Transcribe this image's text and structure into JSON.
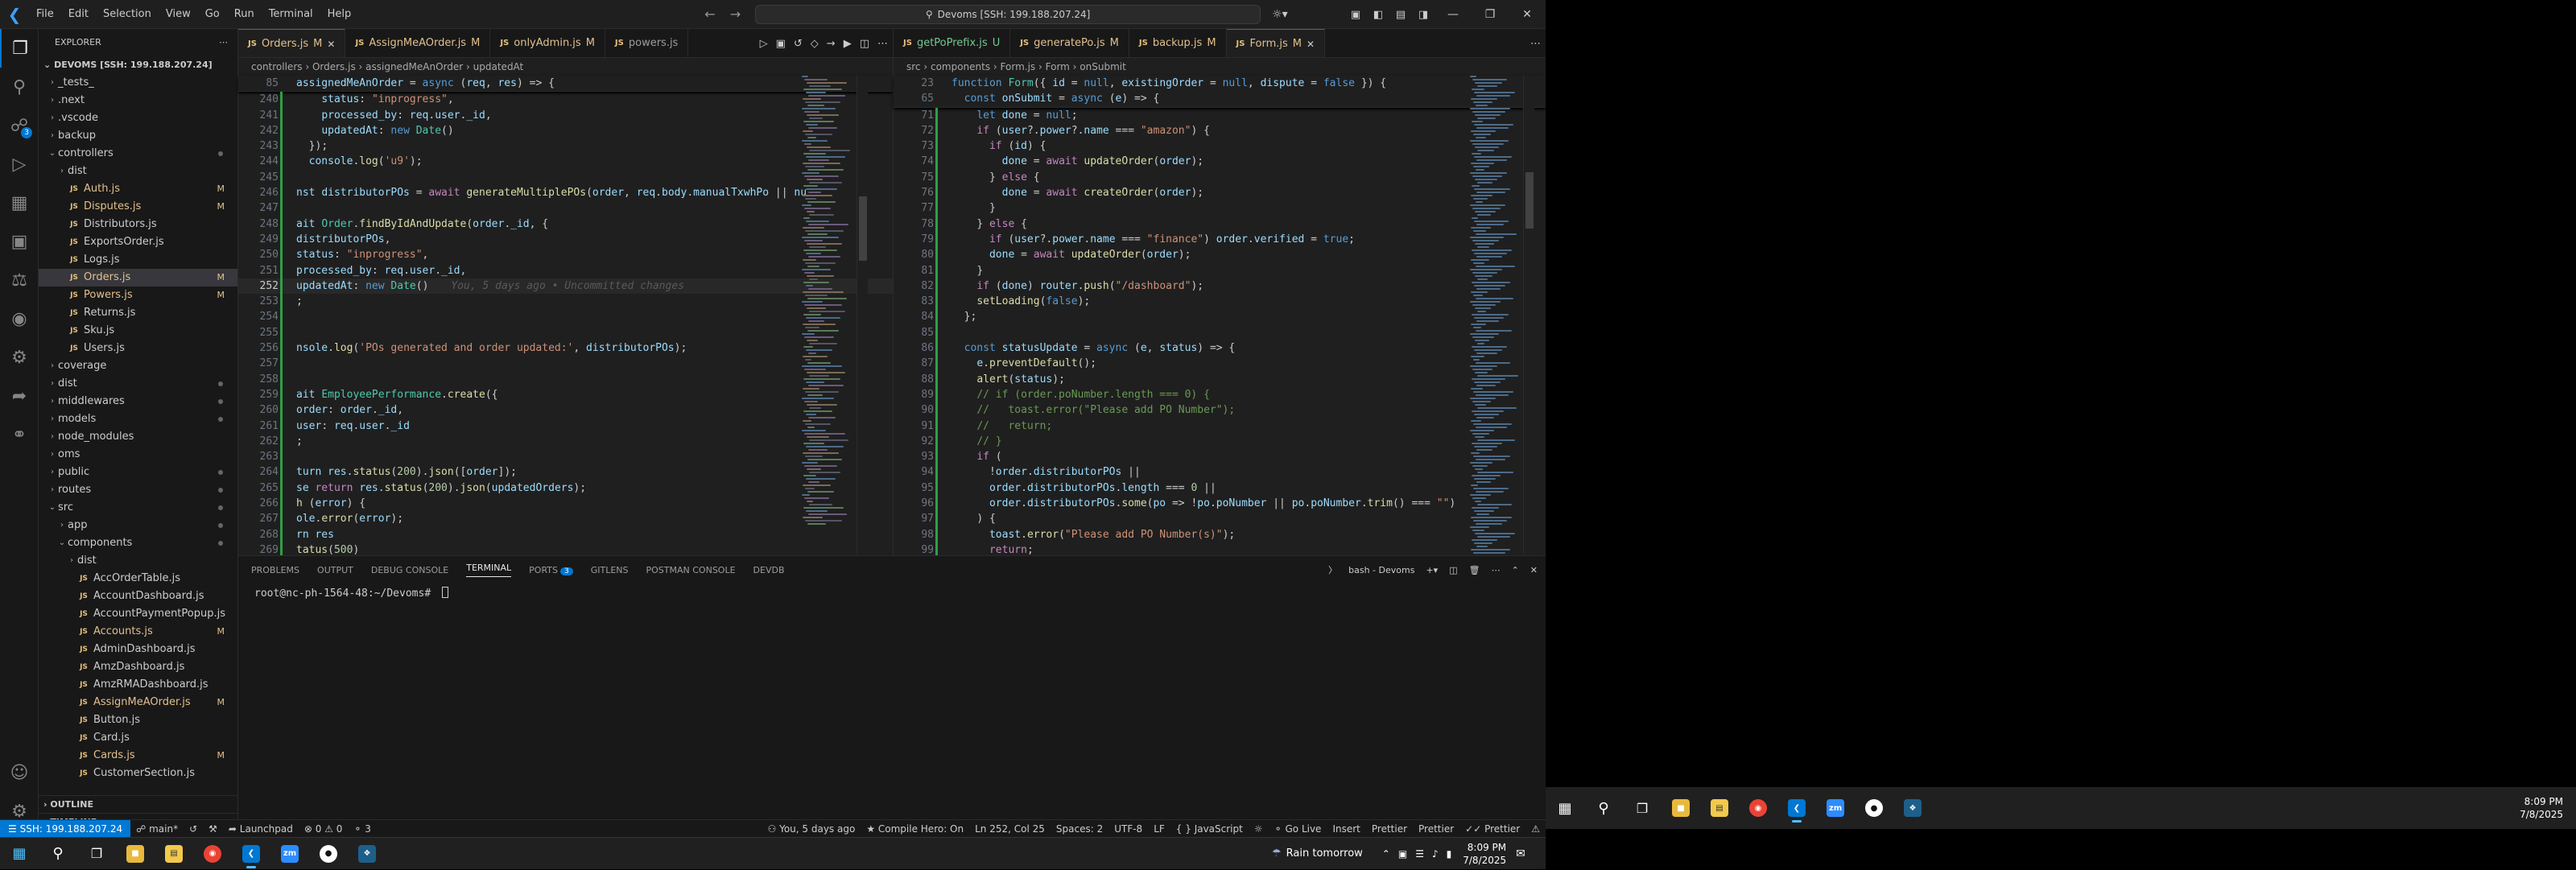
{
  "window": {
    "menus": [
      "File",
      "Edit",
      "Selection",
      "View",
      "Go",
      "Run",
      "Terminal",
      "Help"
    ],
    "command_center": "Devoms [SSH: 199.188.207.24]"
  },
  "explorer": {
    "title": "EXPLORER",
    "root": "DEVOMS [SSH: 199.188.207.24]",
    "items": [
      {
        "label": "_tests_",
        "type": "folder",
        "depth": 0,
        "open": false
      },
      {
        "label": ".next",
        "type": "folder",
        "depth": 0,
        "open": false
      },
      {
        "label": ".vscode",
        "type": "folder",
        "depth": 0,
        "open": false
      },
      {
        "label": "backup",
        "type": "folder",
        "depth": 0,
        "open": false
      },
      {
        "label": "controllers",
        "type": "folder",
        "depth": 0,
        "open": true,
        "dot": true
      },
      {
        "label": "dist",
        "type": "folder",
        "depth": 1,
        "open": false
      },
      {
        "label": "Auth.js",
        "type": "js",
        "depth": 1,
        "status": "M"
      },
      {
        "label": "Disputes.js",
        "type": "js",
        "depth": 1,
        "status": "M"
      },
      {
        "label": "Distributors.js",
        "type": "js",
        "depth": 1
      },
      {
        "label": "ExportsOrder.js",
        "type": "js",
        "depth": 1
      },
      {
        "label": "Logs.js",
        "type": "js",
        "depth": 1
      },
      {
        "label": "Orders.js",
        "type": "js",
        "depth": 1,
        "status": "M",
        "selected": true
      },
      {
        "label": "Powers.js",
        "type": "js",
        "depth": 1,
        "status": "M"
      },
      {
        "label": "Returns.js",
        "type": "js",
        "depth": 1
      },
      {
        "label": "Sku.js",
        "type": "js",
        "depth": 1
      },
      {
        "label": "Users.js",
        "type": "js",
        "depth": 1
      },
      {
        "label": "coverage",
        "type": "folder",
        "depth": 0,
        "open": false
      },
      {
        "label": "dist",
        "type": "folder",
        "depth": 0,
        "open": false,
        "dot": true
      },
      {
        "label": "middlewares",
        "type": "folder",
        "depth": 0,
        "open": false,
        "dot": true
      },
      {
        "label": "models",
        "type": "folder",
        "depth": 0,
        "open": false,
        "dot": true
      },
      {
        "label": "node_modules",
        "type": "folder",
        "depth": 0,
        "open": false
      },
      {
        "label": "oms",
        "type": "folder",
        "depth": 0,
        "open": false
      },
      {
        "label": "public",
        "type": "folder",
        "depth": 0,
        "open": false,
        "dot": true
      },
      {
        "label": "routes",
        "type": "folder",
        "depth": 0,
        "open": false,
        "dot": true
      },
      {
        "label": "src",
        "type": "folder",
        "depth": 0,
        "open": true,
        "dot": true
      },
      {
        "label": "app",
        "type": "folder",
        "depth": 1,
        "open": false,
        "dot": true
      },
      {
        "label": "components",
        "type": "folder",
        "depth": 1,
        "open": true,
        "dot": true
      },
      {
        "label": "dist",
        "type": "folder",
        "depth": 2,
        "open": false
      },
      {
        "label": "AccOrderTable.js",
        "type": "js",
        "depth": 2
      },
      {
        "label": "AccountDashboard.js",
        "type": "js",
        "depth": 2
      },
      {
        "label": "AccountPaymentPopup.js",
        "type": "js",
        "depth": 2
      },
      {
        "label": "Accounts.js",
        "type": "js",
        "depth": 2,
        "status": "M"
      },
      {
        "label": "AdminDashboard.js",
        "type": "js",
        "depth": 2
      },
      {
        "label": "AmzDashboard.js",
        "type": "js",
        "depth": 2
      },
      {
        "label": "AmzRMADashboard.js",
        "type": "js",
        "depth": 2
      },
      {
        "label": "AssignMeAOrder.js",
        "type": "js",
        "depth": 2,
        "status": "M"
      },
      {
        "label": "Button.js",
        "type": "js",
        "depth": 2
      },
      {
        "label": "Card.js",
        "type": "js",
        "depth": 2
      },
      {
        "label": "Cards.js",
        "type": "js",
        "depth": 2,
        "status": "M"
      },
      {
        "label": "CustomerSection.js",
        "type": "js",
        "depth": 2
      }
    ],
    "outline": "OUTLINE",
    "timeline": "TIMELINE"
  },
  "editor_left": {
    "tabs": [
      {
        "label": "Orders.js",
        "status": "M",
        "active": true
      },
      {
        "label": "AssignMeAOrder.js",
        "status": "M"
      },
      {
        "label": "onlyAdmin.js",
        "status": "M"
      },
      {
        "label": "powers.js",
        "status": ""
      }
    ],
    "breadcrumb": [
      "controllers",
      "Orders.js",
      "assignedMeAnOrder",
      "updatedAt"
    ],
    "sticky": {
      "ln": "85",
      "text": "assignedMeAnOrder = async (req, res) => {"
    },
    "lines": [
      {
        "ln": "240",
        "t": "    status: \"inprogress\","
      },
      {
        "ln": "241",
        "t": "    processed_by: req.user._id,"
      },
      {
        "ln": "242",
        "t": "    updatedAt: new Date()"
      },
      {
        "ln": "243",
        "t": "  });"
      },
      {
        "ln": "244",
        "t": "  console.log('u9');"
      },
      {
        "ln": "245",
        "t": ""
      },
      {
        "ln": "246",
        "t": "nst distributorPOs = await generateMultiplePOs(order, req.body.manualTxwhPo || nu"
      },
      {
        "ln": "247",
        "t": ""
      },
      {
        "ln": "248",
        "t": "ait Order.findByIdAndUpdate(order._id, {"
      },
      {
        "ln": "249",
        "t": "distributorPOs,"
      },
      {
        "ln": "250",
        "t": "status: \"inprogress\","
      },
      {
        "ln": "251",
        "t": "processed_by: req.user._id,"
      },
      {
        "ln": "252",
        "t": "updatedAt: new Date()"
      },
      {
        "ln": "253",
        "t": ";"
      },
      {
        "ln": "254",
        "t": ""
      },
      {
        "ln": "255",
        "t": ""
      },
      {
        "ln": "256",
        "t": "nsole.log('POs generated and order updated:', distributorPOs);"
      },
      {
        "ln": "257",
        "t": ""
      },
      {
        "ln": "258",
        "t": ""
      },
      {
        "ln": "259",
        "t": "ait EmployeePerformance.create({"
      },
      {
        "ln": "260",
        "t": "order: order._id,"
      },
      {
        "ln": "261",
        "t": "user: req.user._id"
      },
      {
        "ln": "262",
        "t": ";"
      },
      {
        "ln": "263",
        "t": ""
      },
      {
        "ln": "264",
        "t": "turn res.status(200).json([order]);"
      },
      {
        "ln": "265",
        "t": "se return res.status(200).json(updatedOrders);"
      },
      {
        "ln": "266",
        "t": "h (error) {"
      },
      {
        "ln": "267",
        "t": "ole.error(error);"
      },
      {
        "ln": "268",
        "t": "rn res"
      },
      {
        "ln": "269",
        "t": "tatus(500)"
      }
    ],
    "current_line": "252",
    "blame": "You, 5 days ago • Uncommitted changes"
  },
  "editor_right": {
    "tabs": [
      {
        "label": "getPoPrefix.js",
        "status": "U"
      },
      {
        "label": "generatePo.js",
        "status": "M"
      },
      {
        "label": "backup.js",
        "status": "M"
      },
      {
        "label": "Form.js",
        "status": "M",
        "active": true
      }
    ],
    "breadcrumb": [
      "src",
      "components",
      "Form.js",
      "Form",
      "onSubmit"
    ],
    "sticky": [
      {
        "ln": "23",
        "text": "function Form({ id = null, existingOrder = null, dispute = false }) {"
      },
      {
        "ln": "65",
        "text": "  const onSubmit = async (e) => {"
      }
    ],
    "lines": [
      {
        "ln": "71",
        "t": "    let done = null;"
      },
      {
        "ln": "72",
        "t": "    if (user?.power?.name === \"amazon\") {"
      },
      {
        "ln": "73",
        "t": "      if (id) {"
      },
      {
        "ln": "74",
        "t": "        done = await updateOrder(order);"
      },
      {
        "ln": "75",
        "t": "      } else {"
      },
      {
        "ln": "76",
        "t": "        done = await createOrder(order);"
      },
      {
        "ln": "77",
        "t": "      }"
      },
      {
        "ln": "78",
        "t": "    } else {"
      },
      {
        "ln": "79",
        "t": "      if (user?.power.name === \"finance\") order.verified = true;"
      },
      {
        "ln": "80",
        "t": "      done = await updateOrder(order);"
      },
      {
        "ln": "81",
        "t": "    }"
      },
      {
        "ln": "82",
        "t": "    if (done) router.push(\"/dashboard\");"
      },
      {
        "ln": "83",
        "t": "    setLoading(false);"
      },
      {
        "ln": "84",
        "t": "  };"
      },
      {
        "ln": "85",
        "t": ""
      },
      {
        "ln": "86",
        "t": "  const statusUpdate = async (e, status) => {"
      },
      {
        "ln": "87",
        "t": "    e.preventDefault();"
      },
      {
        "ln": "88",
        "t": "    alert(status);"
      },
      {
        "ln": "89",
        "t": "    // if (order.poNumber.length === 0) {"
      },
      {
        "ln": "90",
        "t": "    //   toast.error(\"Please add PO Number\");"
      },
      {
        "ln": "91",
        "t": "    //   return;"
      },
      {
        "ln": "92",
        "t": "    // }"
      },
      {
        "ln": "93",
        "t": "    if ("
      },
      {
        "ln": "94",
        "t": "      !order.distributorPOs ||"
      },
      {
        "ln": "95",
        "t": "      order.distributorPOs.length === 0 ||"
      },
      {
        "ln": "96",
        "t": "      order.distributorPOs.some(po => !po.poNumber || po.poNumber.trim() === \"\")"
      },
      {
        "ln": "97",
        "t": "    ) {"
      },
      {
        "ln": "98",
        "t": "      toast.error(\"Please add PO Number(s)\");"
      },
      {
        "ln": "99",
        "t": "      return;"
      }
    ]
  },
  "panel": {
    "tabs": [
      "PROBLEMS",
      "OUTPUT",
      "DEBUG CONSOLE",
      "TERMINAL",
      "PORTS",
      "GITLENS",
      "POSTMAN CONSOLE",
      "DEVDB"
    ],
    "active_tab": "TERMINAL",
    "ports_count": "3",
    "terminal_name": "bash - Devoms",
    "prompt": "root@nc-ph-1564-48:~/Devoms#"
  },
  "status": {
    "remote": "SSH: 199.188.207.24",
    "branch": "main*",
    "launchpad": "Launchpad",
    "problems": "0 ⚠ 0",
    "ports": "3",
    "blame": "You, 5 days ago",
    "compile_hero": "Compile Hero: On",
    "position": "Ln 252, Col 25",
    "spaces": "Spaces: 2",
    "encoding": "UTF-8",
    "eol": "LF",
    "language": "JavaScript",
    "golive": "Go Live",
    "insert": "Insert",
    "prettier1": "Prettier",
    "prettier2": "Prettier",
    "prettier3": "Prettier"
  },
  "taskbar": {
    "weather": "Rain tomorrow",
    "time": "8:09 PM",
    "date": "7/8/2025"
  },
  "ext_taskbar": {
    "time": "8:09 PM",
    "date": "7/8/2025"
  },
  "colors": {
    "accent": "#0078d4",
    "modified": "#e2c08d",
    "untracked": "#73c991"
  }
}
